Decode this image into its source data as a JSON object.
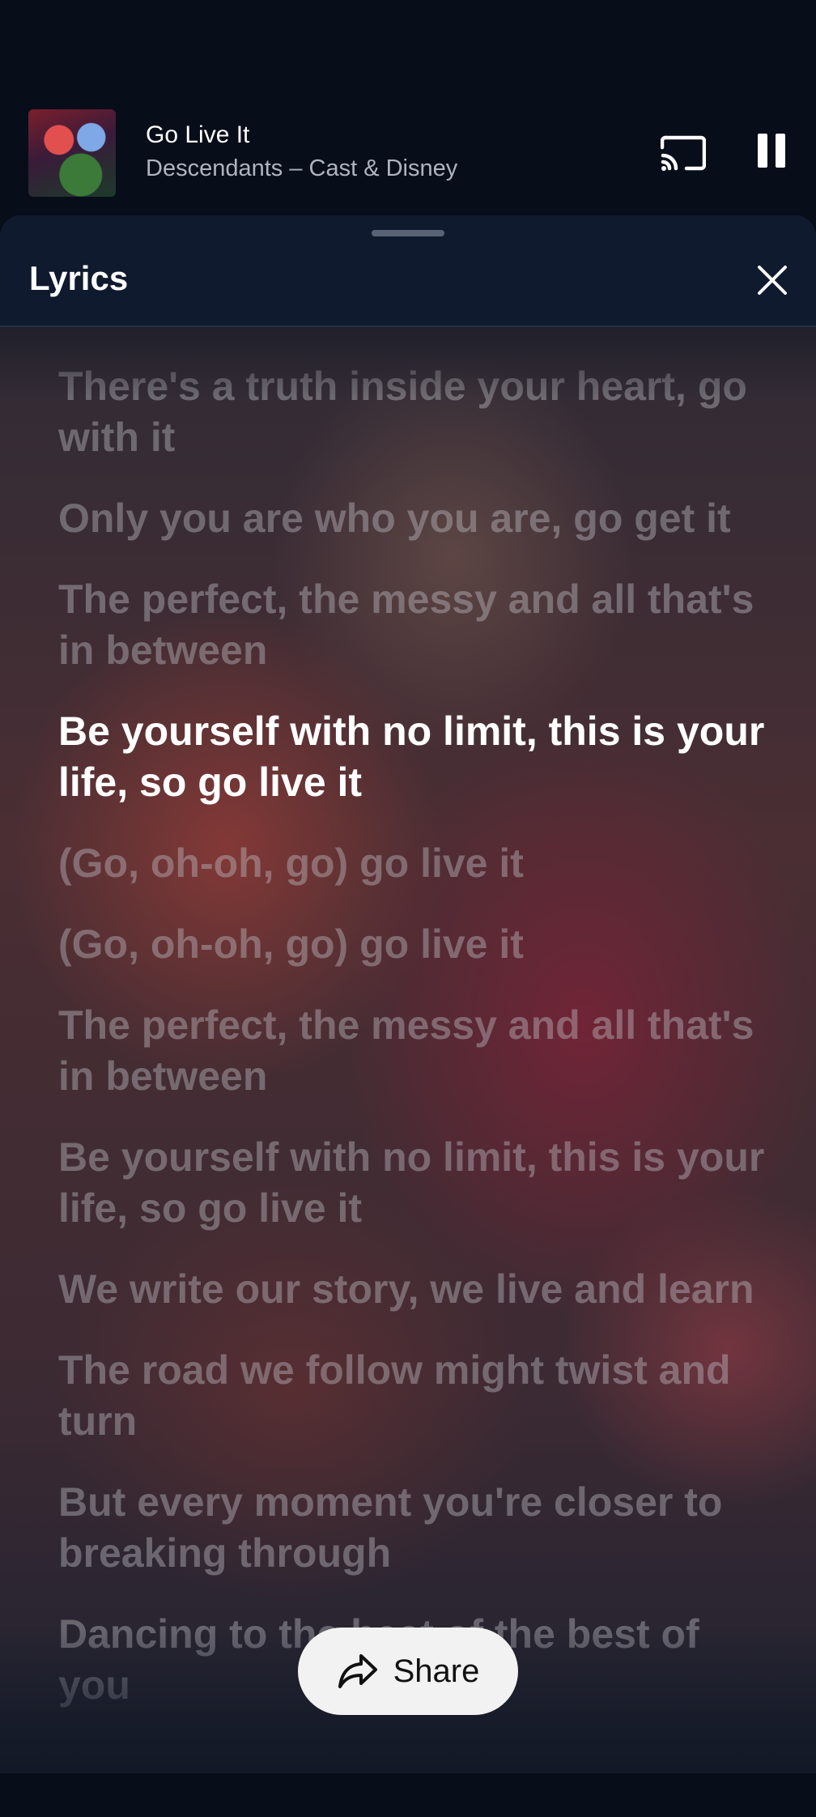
{
  "mini_player": {
    "title": "Go Live It",
    "artist": "Descendants – Cast & Disney",
    "icons": {
      "album_art": "album-art",
      "cast": "cast-icon",
      "pause": "pause-icon"
    }
  },
  "lyrics_panel": {
    "title": "Lyrics",
    "close_icon": "close-icon",
    "lines": [
      "There's a truth inside your heart, go with it",
      "Only you are who you are, go get it",
      "The perfect, the messy and all that's in between",
      "Be yourself with no limit, this is your life, so go live it",
      "(Go, oh-oh, go) go live it",
      "(Go, oh-oh, go) go live it",
      "The perfect, the messy and all that's in between",
      "Be yourself with no limit, this is your life, so go live it",
      "We write our story, we live and learn",
      "The road we follow might twist and turn",
      "But every moment you're closer to breaking through",
      "Dancing to the beat of the best of you"
    ],
    "active_line_index": 3
  },
  "share_button": {
    "label": "Share",
    "icon": "share-icon"
  },
  "colors": {
    "background": "#070d19",
    "header": "#0f1a2e",
    "active_lyric": "#ffffff",
    "inactive_lyric": "#bebec6"
  }
}
